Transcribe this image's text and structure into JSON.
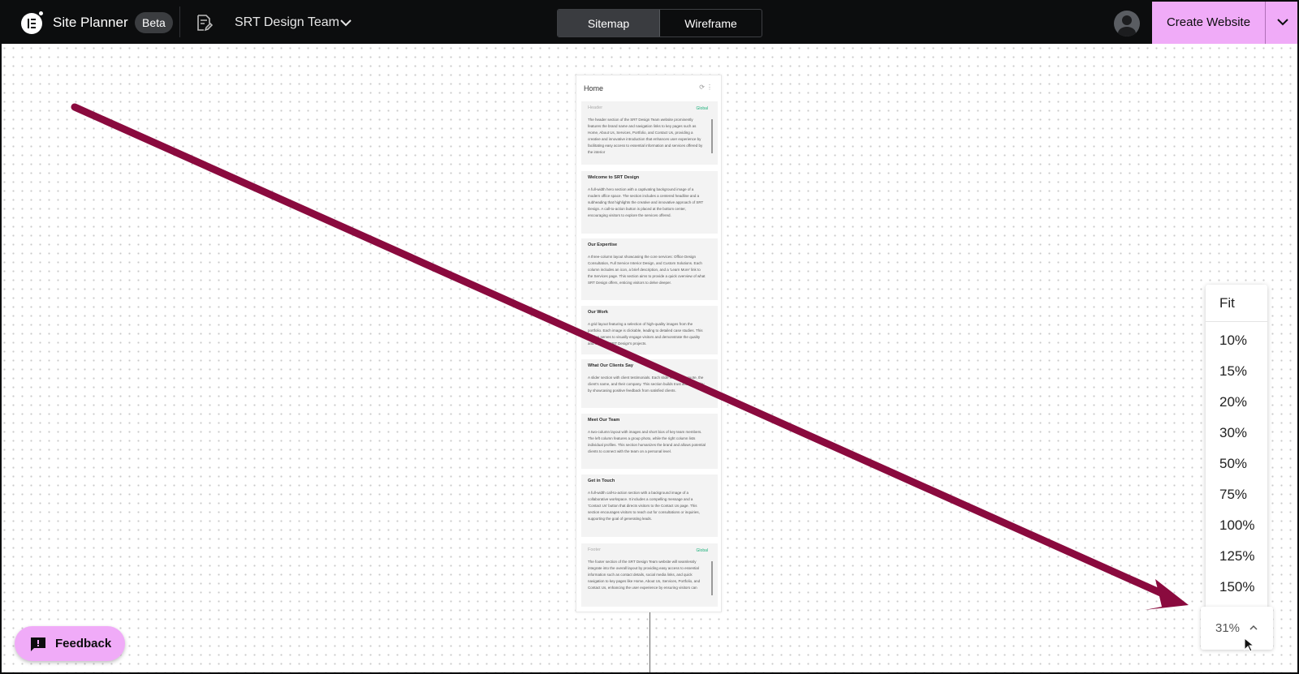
{
  "topbar": {
    "app_title": "Site Planner",
    "badge": "Beta",
    "team_name": "SRT Design Team",
    "tabs": [
      "Sitemap",
      "Wireframe"
    ],
    "active_tab": "Sitemap",
    "create_button": "Create Website",
    "accent_color": "#f0abf8"
  },
  "sitemap": {
    "page_title": "Home",
    "sections": [
      {
        "title": "Header",
        "global_label": "Global",
        "muted": true,
        "description": "The header section of the SRT Design Team website prominently features the brand name and navigation links to key pages such as Home, About Us, Services, Portfolio, and Contact Us, providing a creative and innovative introduction that enhances user experience by facilitating easy access to essential information and services offered by the interior"
      },
      {
        "title": "Welcome to SRT Design",
        "description": "A full-width hero section with a captivating background image of a modern office space. The section includes a centered headline and a subheading that highlights the creative and innovative approach of SRT Design. A call-to-action button is placed at the bottom center, encouraging visitors to explore the services offered."
      },
      {
        "title": "Our Expertise",
        "description": "A three-column layout showcasing the core services: Office Design Consultation, Full Service Interior Design, and Custom Solutions. Each column includes an icon, a brief description, and a 'Learn More' link to the Services page. This section aims to provide a quick overview of what SRT Design offers, enticing visitors to delve deeper."
      },
      {
        "title": "Our Work",
        "description": "A grid layout featuring a selection of high-quality images from the portfolio. Each image is clickable, leading to detailed case studies. This section serves to visually engage visitors and demonstrate the quality and scope of SRT Design's projects."
      },
      {
        "title": "What Our Clients Say",
        "description": "A slider section with client testimonials. Each slide includes a quote, the client's name, and their company. This section builds trust and credibility by showcasing positive feedback from satisfied clients."
      },
      {
        "title": "Meet Our Team",
        "description": "A two-column layout with images and short bios of key team members. The left column features a group photo, while the right column lists individual profiles. This section humanizes the brand and allows potential clients to connect with the team on a personal level."
      },
      {
        "title": "Get in Touch",
        "description": "A full-width call-to-action section with a background image of a collaborative workspace. It includes a compelling message and a 'Contact Us' button that directs visitors to the Contact Us page. This section encourages visitors to reach out for consultations or inquiries, supporting the goal of generating leads."
      },
      {
        "title": "Footer",
        "global_label": "Global",
        "muted": true,
        "description": "The footer section of the SRT Design Team website will seamlessly integrate into the overall layout by providing easy access to essential information such as contact details, social media links, and quick navigation to key pages like Home, About Us, Services, Portfolio, and Contact Us, enhancing the user experience by ensuring visitors can"
      }
    ]
  },
  "zoom": {
    "fit_label": "Fit",
    "options": [
      "10%",
      "15%",
      "20%",
      "30%",
      "50%",
      "75%",
      "100%",
      "125%",
      "150%"
    ],
    "current": "31%"
  },
  "feedback": {
    "label": "Feedback"
  },
  "annotation": {
    "arrow_color": "#8a0a3e"
  }
}
